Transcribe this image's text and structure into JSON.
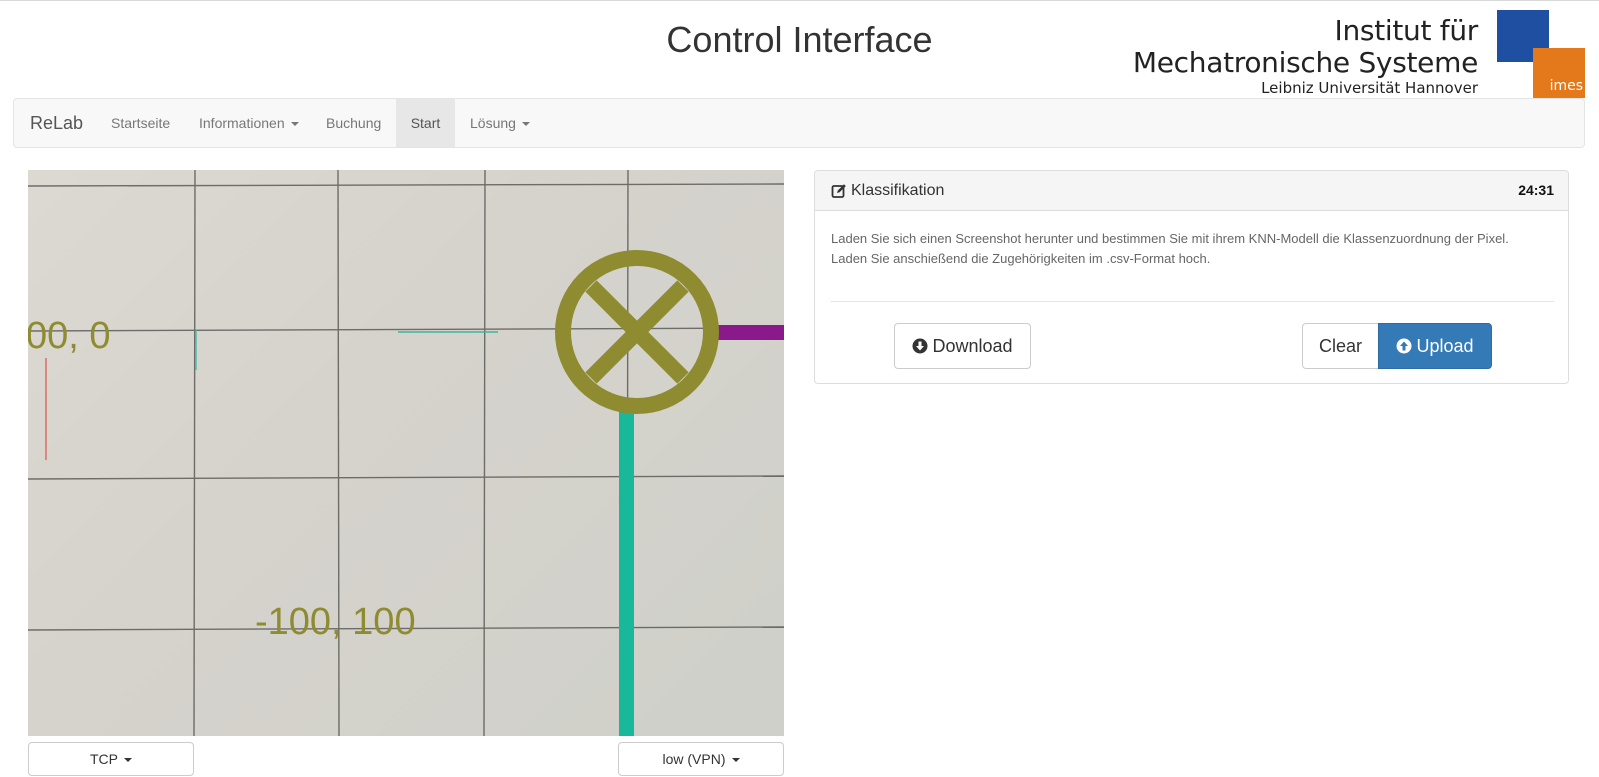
{
  "header": {
    "title": "Control Interface",
    "logo": {
      "line1": "Institut für",
      "line2": "Mechatronische Systeme",
      "line3": "Leibniz Universität Hannover",
      "short": "imes",
      "color_blue": "#1f4fa0",
      "color_orange": "#e3791b"
    }
  },
  "navbar": {
    "brand": "ReLab",
    "items": [
      {
        "label": "Startseite",
        "dropdown": false,
        "active": false
      },
      {
        "label": "Informationen",
        "dropdown": true,
        "active": false
      },
      {
        "label": "Buchung",
        "dropdown": false,
        "active": false
      },
      {
        "label": "Start",
        "dropdown": false,
        "active": true
      },
      {
        "label": "Lösung",
        "dropdown": true,
        "active": false
      }
    ]
  },
  "camera": {
    "labels": [
      "00, 0",
      "-100, 100"
    ],
    "protocol_select": "TCP",
    "quality_select": "low (VPN)"
  },
  "panel": {
    "icon": "edit-icon",
    "title": "Klassifikation",
    "timer": "24:31",
    "text": "Laden Sie sich einen Screenshot herunter und bestimmen Sie mit ihrem KNN-Modell die Klassenzuordnung der Pixel. Laden Sie anschießend die Zugehörigkeiten im .csv-Format hoch.",
    "download_label": "Download",
    "clear_label": "Clear",
    "upload_label": "Upload",
    "accent": "#337ab7"
  }
}
